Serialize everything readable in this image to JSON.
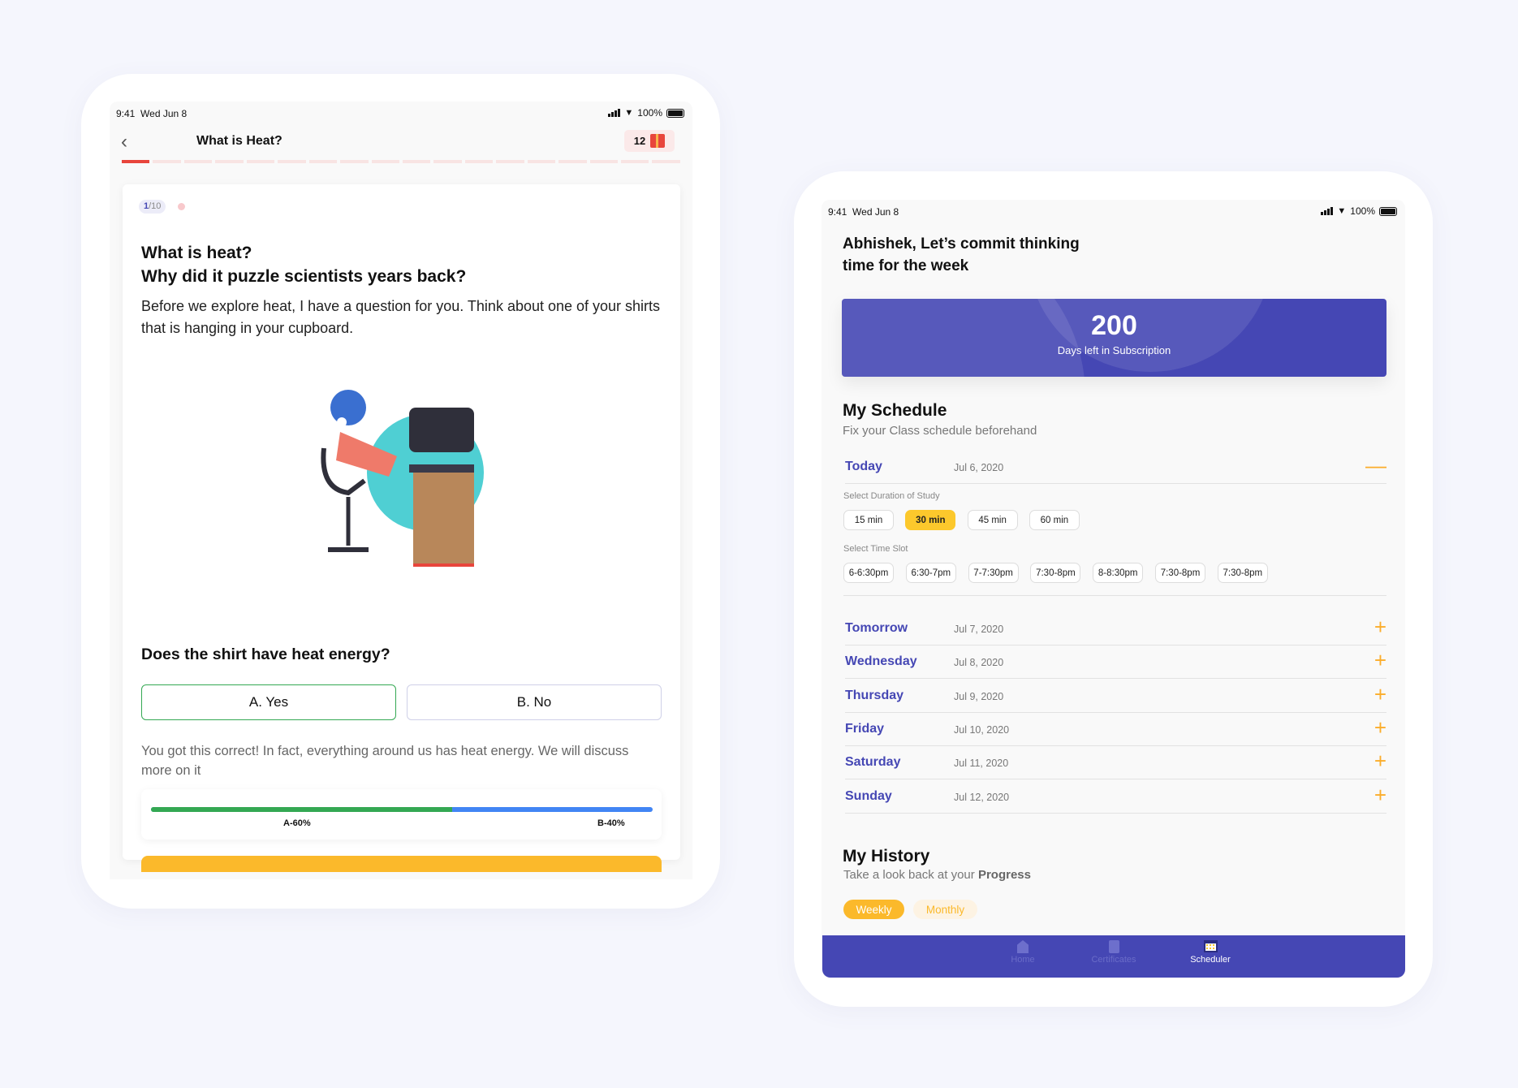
{
  "left_device": {
    "status": {
      "time": "9:41",
      "date": "Wed Jun 8",
      "battery": "100%"
    },
    "header": {
      "title": "What is Heat?",
      "gift_count": "12",
      "gift_icon": "gift-icon",
      "back_icon": "chevron-left-icon"
    },
    "progress": {
      "segments": 18,
      "completed": 1,
      "active_color": "#e8453c",
      "inactive_color": "#f8e4e3"
    },
    "card": {
      "badge_current": "1",
      "badge_total": "/10",
      "title_line1": "What is heat?",
      "title_line2": "Why did it puzzle scientists years back?",
      "paragraph": "Before we explore heat, I have a question for you. Think about one of your shirts that is hanging in your cupboard.",
      "question": "Does the shirt have heat energy?",
      "options": [
        "A. Yes",
        "B. No"
      ],
      "selected_option": "A. Yes",
      "feedback": "You got this correct! In fact, everything around us has heat  energy. We will discuss more on it",
      "results": {
        "a_label": "A-60%",
        "b_label": "B-40%",
        "a_percent": 60,
        "b_percent": 40,
        "a_color": "#34a853",
        "b_color": "#4285f4"
      }
    }
  },
  "right_device": {
    "status": {
      "time": "9:41",
      "date": "Wed Jun 8",
      "battery": "100%"
    },
    "heading_line1": "Abhishek, Let’s commit thinking",
    "heading_line2": "time for the week",
    "banner": {
      "value": "200",
      "label": "Days left in Subscription",
      "color": "#4547b4"
    },
    "schedule": {
      "title": "My Schedule",
      "subtitle": "Fix your Class schedule beforehand",
      "today": {
        "name": "Today",
        "date": "Jul 6, 2020"
      },
      "duration_label": "Select Duration of Study",
      "durations": [
        "15 min",
        "30 min",
        "45 min",
        "60 min"
      ],
      "selected_duration": "30 min",
      "slot_label": "Select Time Slot",
      "slots": [
        "6-6:30pm",
        "6:30-7pm",
        "7-7:30pm",
        "7:30-8pm",
        "8-8:30pm",
        "7:30-8pm",
        "7:30-8pm"
      ],
      "days": [
        {
          "name": "Tomorrow",
          "date": "Jul 7, 2020"
        },
        {
          "name": "Wednesday",
          "date": "Jul 8, 2020"
        },
        {
          "name": "Thursday",
          "date": "Jul 9, 2020"
        },
        {
          "name": "Friday",
          "date": "Jul 10, 2020"
        },
        {
          "name": "Saturday",
          "date": "Jul 11, 2020"
        },
        {
          "name": "Sunday",
          "date": "Jul 12, 2020"
        }
      ]
    },
    "history": {
      "title": "My History",
      "subtitle_prefix": "Take a look back at your ",
      "subtitle_bold": "Progress",
      "tabs": [
        "Weekly",
        "Monthly"
      ],
      "selected_tab": "Weekly"
    },
    "tabbar": {
      "items": [
        {
          "label": "Home",
          "icon": "home-icon"
        },
        {
          "label": "Certificates",
          "icon": "certificate-icon"
        },
        {
          "label": "Scheduler",
          "icon": "calendar-icon"
        }
      ],
      "active": "Scheduler"
    }
  }
}
